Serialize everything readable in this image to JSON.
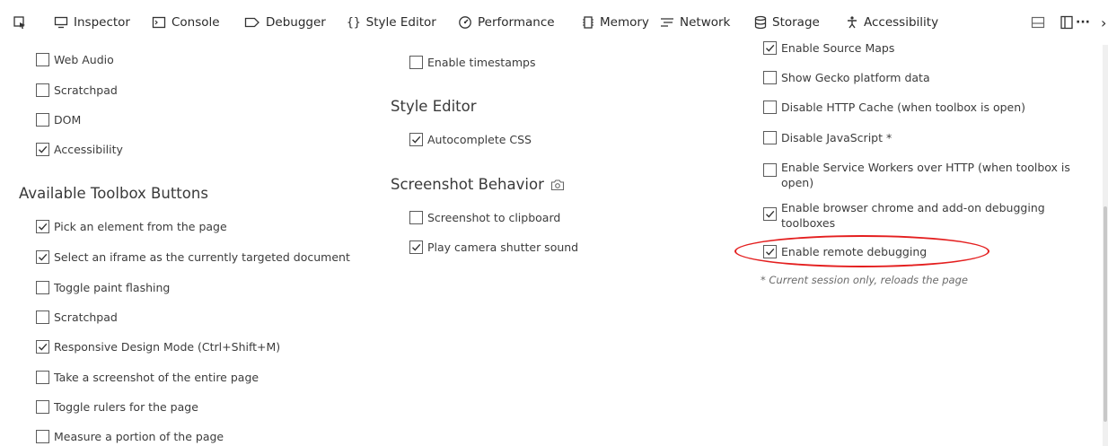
{
  "toolbar": {
    "tabs": [
      {
        "label": "Inspector",
        "icon": "inspector-icon"
      },
      {
        "label": "Console",
        "icon": "console-icon"
      },
      {
        "label": "Debugger",
        "icon": "debugger-icon"
      },
      {
        "label": "Style Editor",
        "icon": "style-editor-icon"
      },
      {
        "label": "Performance",
        "icon": "performance-icon"
      },
      {
        "label": "Memory",
        "icon": "memory-icon"
      },
      {
        "label": "Network",
        "icon": "network-icon"
      },
      {
        "label": "Storage",
        "icon": "storage-icon"
      },
      {
        "label": "Accessibility",
        "icon": "accessibility-icon"
      }
    ],
    "more_label": "···",
    "overflow_label": "›"
  },
  "left": {
    "panels": [
      {
        "label": "Web Audio",
        "checked": false
      },
      {
        "label": "Scratchpad",
        "checked": false
      },
      {
        "label": "DOM",
        "checked": false
      },
      {
        "label": "Accessibility",
        "checked": true
      }
    ],
    "toolbox_heading": "Available Toolbox Buttons",
    "buttons": [
      {
        "label": "Pick an element from the page",
        "checked": true
      },
      {
        "label": "Select an iframe as the currently targeted document",
        "checked": true
      },
      {
        "label": "Toggle paint flashing",
        "checked": false
      },
      {
        "label": "Scratchpad",
        "checked": false
      },
      {
        "label": "Responsive Design Mode (Ctrl+Shift+M)",
        "checked": true
      },
      {
        "label": "Take a screenshot of the entire page",
        "checked": false
      },
      {
        "label": "Toggle rulers for the page",
        "checked": false
      },
      {
        "label": "Measure a portion of the page",
        "checked": false
      }
    ]
  },
  "middle": {
    "timestamps": {
      "label": "Enable timestamps",
      "checked": false
    },
    "style_editor_heading": "Style Editor",
    "autocomplete": {
      "label": "Autocomplete CSS",
      "checked": true
    },
    "screenshot_heading": "Screenshot Behavior",
    "screenshot_clipboard": {
      "label": "Screenshot to clipboard",
      "checked": false
    },
    "shutter_sound": {
      "label": "Play camera shutter sound",
      "checked": true
    }
  },
  "right": {
    "options": [
      {
        "label": "Enable Source Maps",
        "checked": true
      },
      {
        "label": "Show Gecko platform data",
        "checked": false
      },
      {
        "label": "Disable HTTP Cache (when toolbox is open)",
        "checked": false
      },
      {
        "label": "Disable JavaScript *",
        "checked": false
      },
      {
        "label": "Enable Service Workers over HTTP (when toolbox is open)",
        "checked": false
      },
      {
        "label": "Enable browser chrome and add-on debugging toolboxes",
        "checked": true
      },
      {
        "label": "Enable remote debugging",
        "checked": true
      }
    ],
    "note": "* Current session only, reloads the page"
  },
  "colors": {
    "highlight": "#e41f1f",
    "checkbox_border": "#5a5a5a"
  }
}
